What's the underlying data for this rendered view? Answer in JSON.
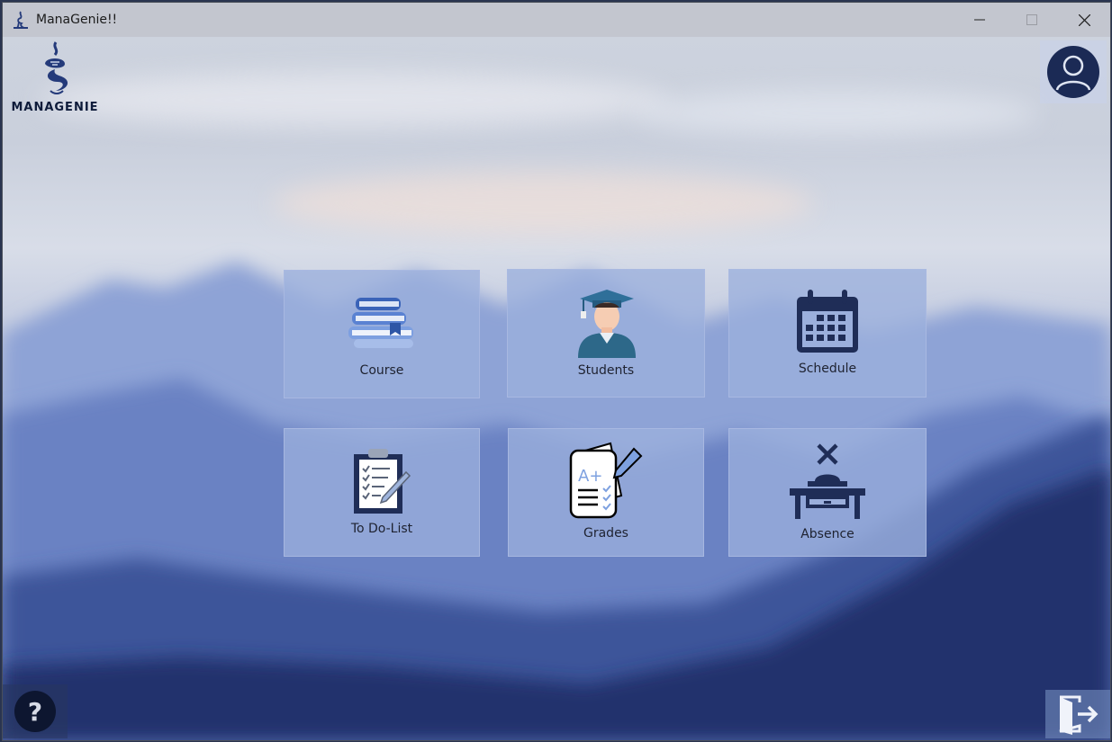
{
  "window": {
    "title": "ManaGenie!!",
    "controls": {
      "minimize": "–",
      "maximize": "☐",
      "close": "✕"
    }
  },
  "logo": {
    "text": "MANAGENIE",
    "icon": "genie-lamp-icon"
  },
  "profile": {
    "icon": "user-avatar-icon"
  },
  "tiles": [
    {
      "label": "Course",
      "icon": "books-icon"
    },
    {
      "label": "Students",
      "icon": "graduate-student-icon"
    },
    {
      "label": "Schedule",
      "icon": "calendar-icon"
    },
    {
      "label": "To Do-List",
      "icon": "clipboard-checklist-icon"
    },
    {
      "label": "Grades",
      "icon": "graded-paper-icon"
    },
    {
      "label": "Absence",
      "icon": "empty-desk-icon"
    }
  ],
  "help": {
    "icon": "question-icon"
  },
  "exit": {
    "icon": "logout-door-icon"
  },
  "colors": {
    "accent_dark": "#1b2a55",
    "tile_bg": "#9bafdc",
    "icon_navy": "#1f2d57"
  }
}
